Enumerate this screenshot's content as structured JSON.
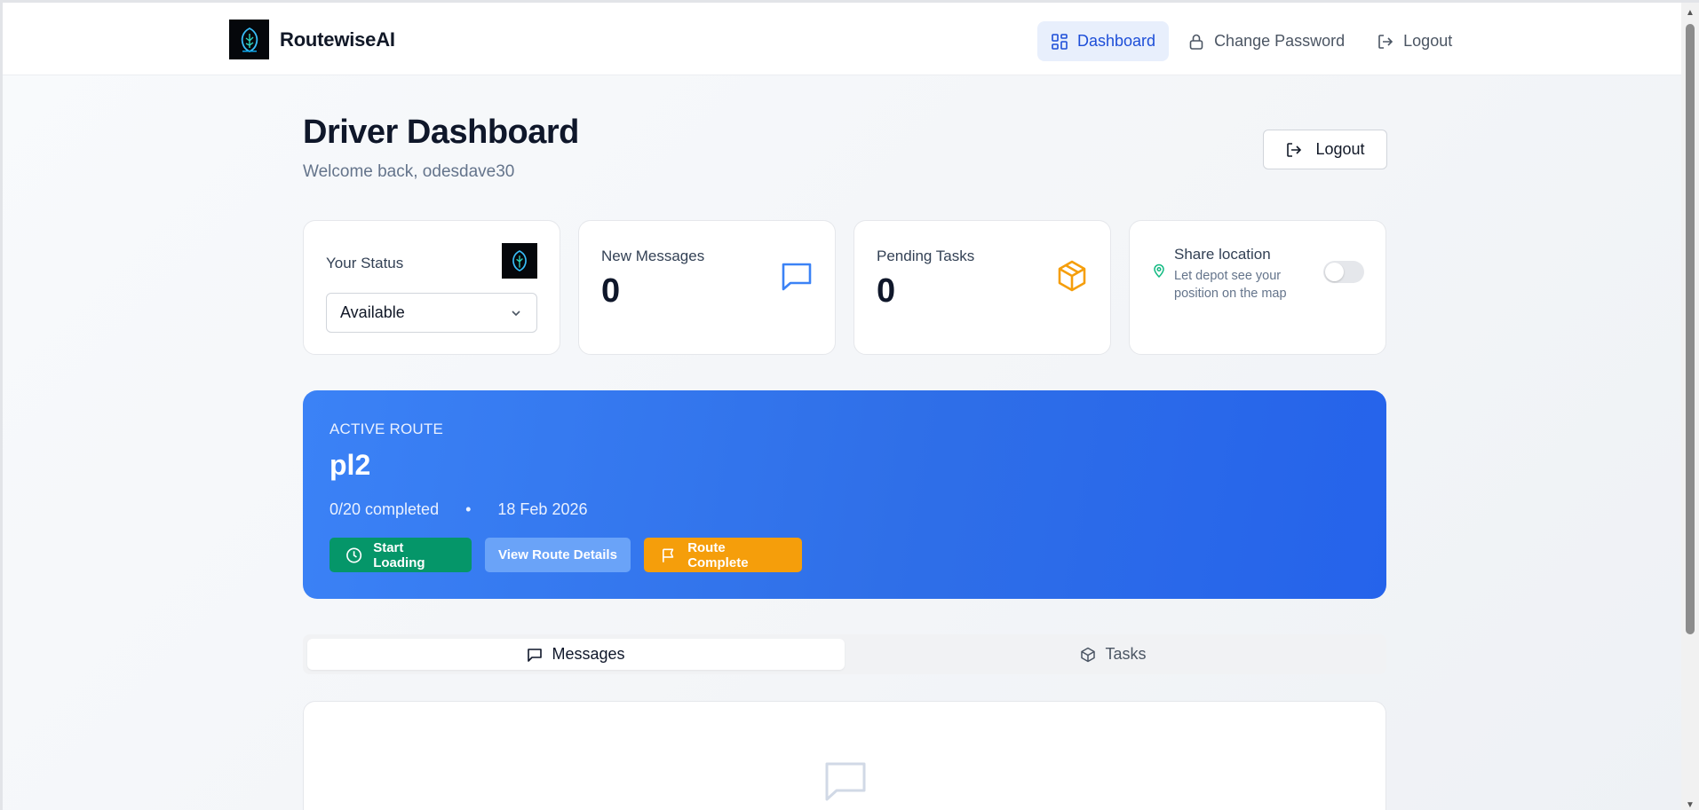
{
  "app": {
    "name": "RoutewiseAI"
  },
  "nav": {
    "items": [
      {
        "label": "Dashboard",
        "icon": "dashboard-grid-icon",
        "active": true
      },
      {
        "label": "Change Password",
        "icon": "lock-icon",
        "active": false
      },
      {
        "label": "Logout",
        "icon": "logout-icon",
        "active": false
      }
    ]
  },
  "header": {
    "title": "Driver Dashboard",
    "subtitle": "Welcome back, odesdave30",
    "logout_label": "Logout"
  },
  "cards": {
    "status": {
      "label": "Your Status",
      "selected": "Available"
    },
    "messages": {
      "label": "New Messages",
      "value": "0",
      "icon": "message-square-icon"
    },
    "tasks": {
      "label": "Pending Tasks",
      "value": "0",
      "icon": "package-icon"
    },
    "share": {
      "title": "Share location",
      "description": "Let depot see your position on the map",
      "enabled": false
    }
  },
  "route": {
    "kicker": "ACTIVE ROUTE",
    "name": "pl2",
    "progress": "0/20 completed",
    "separator": "•",
    "date": "18 Feb 2026",
    "actions": {
      "start_loading": "Start Loading",
      "view_details": "View Route Details",
      "complete": "Route Complete"
    }
  },
  "tabs": [
    {
      "label": "Messages",
      "icon": "message-square-icon",
      "active": true
    },
    {
      "label": "Tasks",
      "icon": "package-icon",
      "active": false
    }
  ],
  "colors": {
    "accent_blue": "#2563eb",
    "nav_active_bg": "#e8effc",
    "green": "#059669",
    "orange": "#f59e0b"
  }
}
